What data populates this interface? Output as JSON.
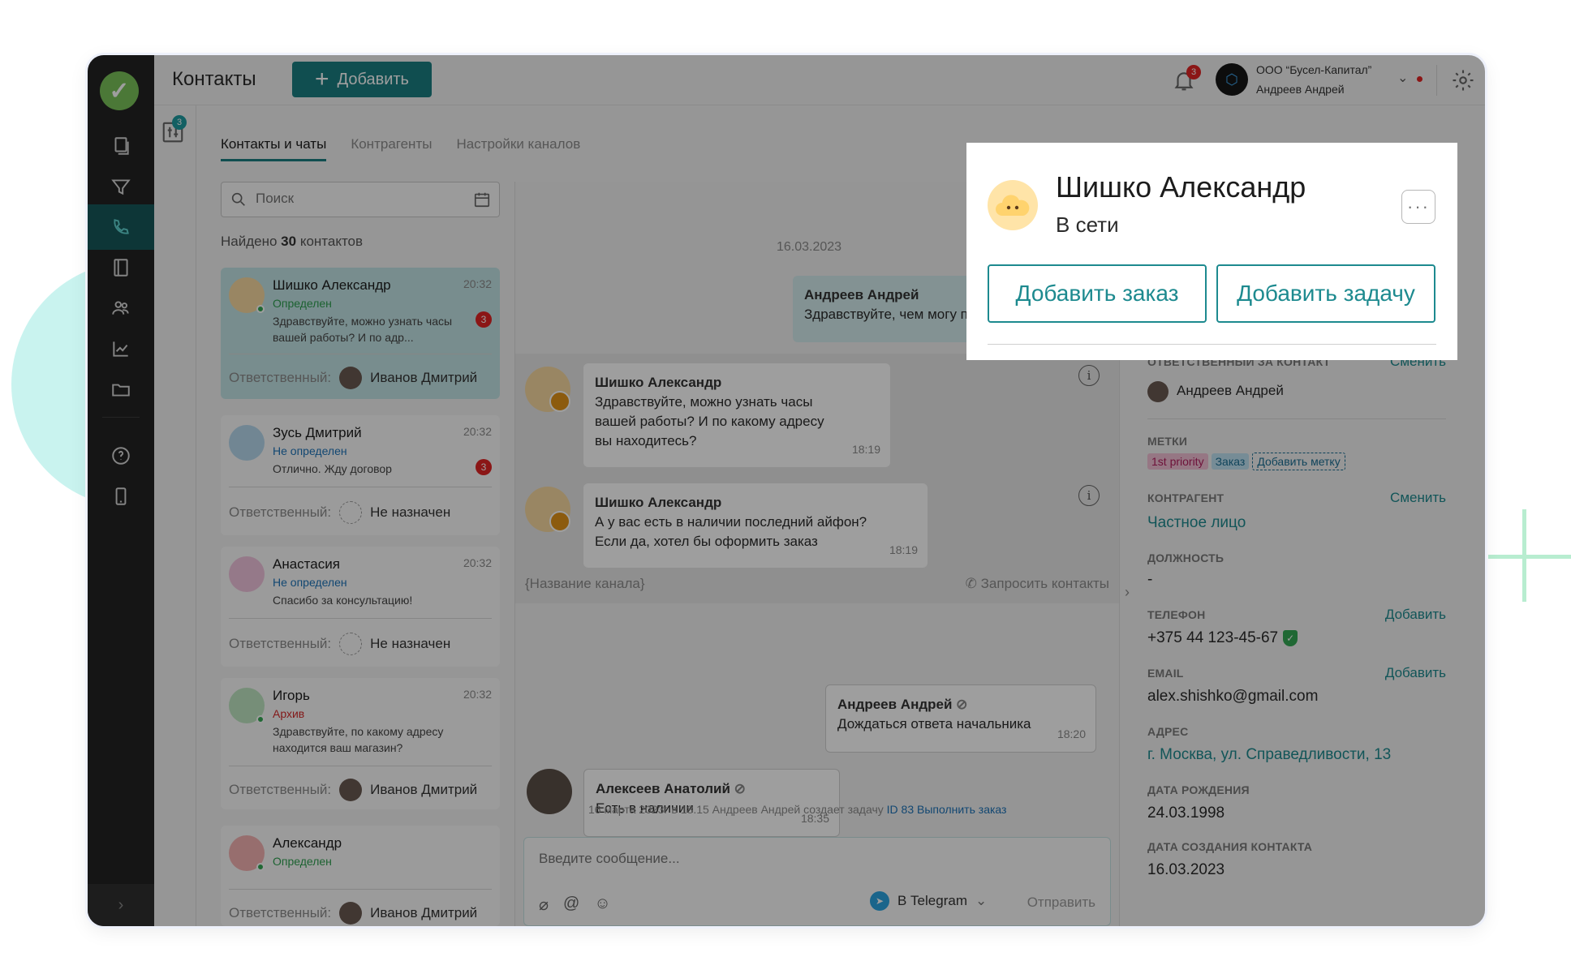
{
  "header": {
    "title": "Контакты",
    "add_label": "Добавить",
    "notifications_count": "3",
    "org_name": "ООО “Бусел-Капитал”",
    "org_user": "Андреев Андрей"
  },
  "strip": {
    "badge": "3"
  },
  "tabs": [
    {
      "label": "Контакты и чаты",
      "active": true
    },
    {
      "label": "Контрагенты",
      "active": false
    },
    {
      "label": "Настройки каналов",
      "active": false
    }
  ],
  "search": {
    "placeholder": "Поиск"
  },
  "found": {
    "prefix": "Найдено ",
    "count": "30",
    "suffix": " контактов"
  },
  "contacts": [
    {
      "name": "Шишко Александр",
      "time": "20:32",
      "status": "Определен",
      "message": "Здравствуйте, можно узнать часы вашей работы? И по адр...",
      "unread": "3",
      "resp_label": "Ответственный:",
      "resp_name": "Иванов Дмитрий"
    },
    {
      "name": "Зусь Дмитрий",
      "time": "20:32",
      "status": "Не определен",
      "message": "Отлично. Жду договор",
      "unread": "3",
      "resp_label": "Ответственный:",
      "resp_name": "Не назначен"
    },
    {
      "name": "Анастасия",
      "time": "20:32",
      "status": "Не определен",
      "message": "Спасибо за консультацию!",
      "resp_label": "Ответственный:",
      "resp_name": "Не назначен"
    },
    {
      "name": "Игорь",
      "time": "20:32",
      "status": "Архив",
      "message": "Здравствуйте, по какому адресу находится ваш магазин?",
      "resp_label": "Ответственный:",
      "resp_name": "Иванов Дмитрий"
    },
    {
      "name": "Александр",
      "status": "Определен",
      "resp_label": "Ответственный:",
      "resp_name": "Иванов Дмитрий"
    }
  ],
  "chat": {
    "date": "16.03.2023",
    "messages": [
      {
        "author": "Андреев Андрей",
        "text": "Здравствуйте, чем могу по"
      },
      {
        "author": "Шишко Александр",
        "text": "Здравствуйте, можно узнать часы вашей работы? И по какому адресу вы находитесь?",
        "time": "18:19"
      },
      {
        "author": "Шишко Александр",
        "text": "А у вас есть в наличии последний айфон? Если да, хотел бы оформить заказ",
        "time": "18:19"
      },
      {
        "author": "Андреев Андрей",
        "text": "Дождаться ответа начальника",
        "time": "18:20"
      },
      {
        "author": "Алексеев Анатолий",
        "text": "Есть в наличии",
        "time": "18:35"
      }
    ],
    "channel_name": "{Название канала}",
    "request_contacts": "Запросить контакты",
    "system_text": "16 марта 2023г в 18.15 Андреев Андрей создает задачу ",
    "system_link": "ID 83 Выполнить заказ",
    "composer_placeholder": "Введите сообщение...",
    "channel_select": "В Telegram",
    "send_label": "Отправить"
  },
  "details": {
    "responsible_label": "ОТВЕТСТВЕННЫЙ ЗА КОНТАКТ",
    "responsible_action": "Сменить",
    "responsible_name": "Андреев Андрей",
    "tags_label": "МЕТКИ",
    "tags": [
      "1st priority",
      "Заказ"
    ],
    "add_tag": "Добавить метку",
    "counterparty_label": "КОНТРАГЕНТ",
    "counterparty_action": "Сменить",
    "counterparty_value": "Частное лицо",
    "position_label": "ДОЛЖНОСТЬ",
    "position_value": "-",
    "phone_label": "ТЕЛЕФОН",
    "phone_action": "Добавить",
    "phone_value": "+375 44 123-45-67",
    "email_label": "EMAIL",
    "email_action": "Добавить",
    "email_value": "alex.shishko@gmail.com",
    "address_label": "АДРЕС",
    "address_value": "г. Москва, ул. Справедливости, 13",
    "birth_label": "ДАТА РОЖДЕНИЯ",
    "birth_value": "24.03.1998",
    "created_label": "ДАТА СОЗДАНИЯ КОНТАКТА",
    "created_value": "16.03.2023"
  },
  "popup": {
    "name": "Шишко Александр",
    "status": "В сети",
    "add_order": "Добавить заказ",
    "add_task": "Добавить задачу"
  },
  "colors": {
    "accent": "#1b7f82",
    "nav_bg": "#232323",
    "badge_red": "#e02424",
    "online_green": "#35a854"
  }
}
